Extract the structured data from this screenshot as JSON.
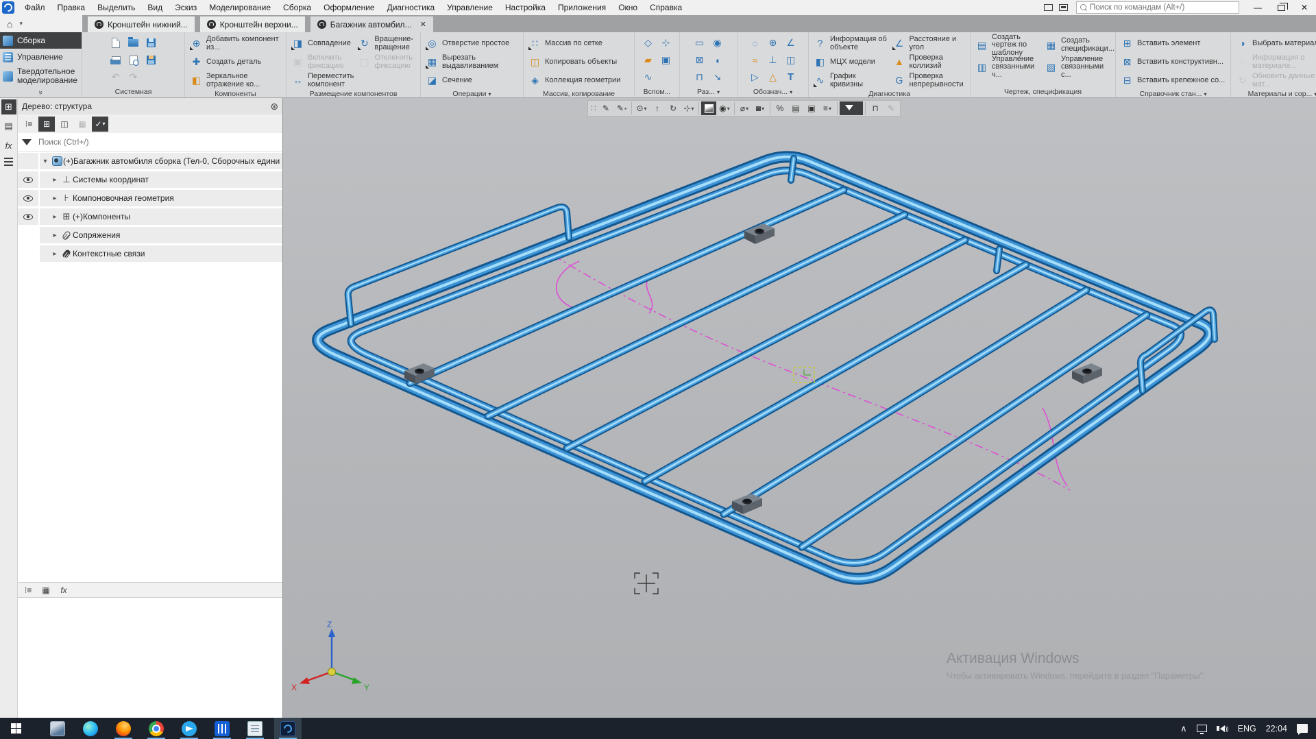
{
  "window": {
    "search_placeholder": "Поиск по командам (Alt+/)"
  },
  "menu": {
    "items": [
      "Файл",
      "Правка",
      "Выделить",
      "Вид",
      "Эскиз",
      "Моделирование",
      "Сборка",
      "Оформление",
      "Диагностика",
      "Управление",
      "Настройка",
      "Приложения",
      "Окно",
      "Справка"
    ]
  },
  "doc_tabs": {
    "close_glyph": "✕",
    "tabs": [
      {
        "label": "Кронштейн нижний..."
      },
      {
        "label": "Кронштейн верхни..."
      },
      {
        "label": "Багажник автомбил...",
        "active": true
      }
    ]
  },
  "mode_tabs": {
    "items": [
      "Сборка",
      "Управление",
      "Твердотельное моделирование"
    ]
  },
  "ribbon": {
    "groups": [
      {
        "label": "Системная",
        "icons": [
          "new-document",
          "open-document",
          "save",
          "print",
          "print-preview",
          "save-all",
          "undo",
          "redo"
        ]
      },
      {
        "label": "Компоненты",
        "buttons": [
          {
            "label": "Добавить компонент из..."
          },
          {
            "label": "Создать деталь"
          },
          {
            "label": "Зеркальное отражение ко..."
          }
        ],
        "icons": [
          "add-component",
          "create-part",
          "mirror-components"
        ]
      },
      {
        "label": "Размещение компонентов",
        "col1": [
          {
            "label": "Совпадение"
          },
          {
            "label": "Включить фиксацию",
            "disabled": true
          },
          {
            "label": "Переместить компонент"
          }
        ],
        "col2": [
          {
            "label": "Вращение-вращение"
          },
          {
            "label": "Отключить фиксацию",
            "disabled": true
          }
        ],
        "icons": [
          "coincident-mate",
          "enable-fixation",
          "move-component",
          "rotation-rotation",
          "disable-fixation"
        ]
      },
      {
        "label": "Операции",
        "dropdown": true,
        "buttons": [
          {
            "label": "Отверстие простое"
          },
          {
            "label": "Вырезать выдавливанием"
          },
          {
            "label": "Сечение"
          }
        ],
        "icons": [
          "simple-hole",
          "cut-extrude",
          "section"
        ]
      },
      {
        "label": "Массив, копирование",
        "buttons": [
          {
            "label": "Массив по сетке"
          },
          {
            "label": "Копировать объекты"
          },
          {
            "label": "Коллекция геометрии"
          }
        ],
        "icons": [
          "grid-array",
          "copy-objects",
          "geometry-collection"
        ]
      },
      {
        "label": "Вспом...",
        "icons": [
          "aux-plane",
          "aux-cs",
          "aux-layer",
          "aux-camera",
          "aux-spline"
        ]
      },
      {
        "label": "Раз...",
        "dropdown": true,
        "icons": [
          "section-view",
          "detail-view",
          "break-view",
          "removed-view",
          "scale-view",
          "bend-view"
        ]
      },
      {
        "label": "Обознач...",
        "dropdown": true,
        "icons": [
          "hole-mark",
          "axis-mark",
          "angle-mark",
          "leader",
          "slope",
          "datum",
          "flag",
          "tolerance",
          "text"
        ]
      },
      {
        "label": "Диагностика",
        "col1": [
          {
            "label": "Информация об объекте"
          },
          {
            "label": "МЦХ модели"
          },
          {
            "label": "График кривизны"
          }
        ],
        "col2": [
          {
            "label": "Расстояние и угол"
          },
          {
            "label": "Проверка коллизий"
          },
          {
            "label": "Проверка непрерывности"
          }
        ],
        "icons": [
          "object-info",
          "mass-properties",
          "curvature-graph",
          "distance-angle",
          "collision-check",
          "continuity-check"
        ]
      },
      {
        "label": "Чертеж, спецификация",
        "col1": [
          {
            "label": "Создать чертеж по шаблону"
          },
          {
            "label": "Управление связанными ч..."
          }
        ],
        "col2": [
          {
            "label": "Создать спецификаци..."
          },
          {
            "label": "Управление связанными с..."
          }
        ],
        "icons": [
          "create-drawing-template",
          "manage-linked-drawings",
          "create-specification",
          "manage-linked-specs"
        ]
      },
      {
        "label": "Справочник стан...",
        "dropdown": true,
        "buttons": [
          {
            "label": "Вставить элемент"
          },
          {
            "label": "Вставить конструктивн..."
          },
          {
            "label": "Вставить крепежное со..."
          }
        ],
        "icons": [
          "insert-element",
          "insert-constructive",
          "insert-fastener"
        ]
      },
      {
        "label": "Материалы и сор...",
        "dropdown": true,
        "buttons": [
          {
            "label": "Выбрать материал..."
          },
          {
            "label": "Информация о материале...",
            "disabled": true
          },
          {
            "label": "Обновить данные по мат...",
            "disabled": true
          }
        ],
        "icons": [
          "select-material",
          "material-info",
          "refresh-material-data"
        ]
      }
    ]
  },
  "tree": {
    "title": "Дерево: структура",
    "search_placeholder": "Поиск (Ctrl+/)",
    "root_label": "(+)Багажник автомбиля сборка (Тел-0, Сборочных едини",
    "items": [
      {
        "label": "Системы координат",
        "eye": true
      },
      {
        "label": "Компоновочная геометрия",
        "eye": true
      },
      {
        "label": "(+)Компоненты",
        "eye": true
      },
      {
        "label": "Сопряжения",
        "eye": false
      },
      {
        "label": "Контекстные связи",
        "eye": false
      }
    ],
    "side_icons": [
      "structure-tree",
      "parameters",
      "fx",
      "menu"
    ]
  },
  "viewport": {
    "toolbar_icons": [
      "grip",
      "sketch",
      "sketch-on-plane",
      "zoom",
      "zoom-fit",
      "rotate-view",
      "coordinate",
      "shaded-view",
      "orientation",
      "hide-objects",
      "snapshot",
      "clip-split",
      "notebook",
      "appearance",
      "scene-layers",
      "filter",
      "measure",
      "eyedropper"
    ],
    "watermark": {
      "title": "Активация Windows",
      "subtitle": "Чтобы активировать Windows, перейдите в раздел \"Параметры\"."
    },
    "triad": {
      "x": "X",
      "y": "Y",
      "z": "Z"
    }
  },
  "taskbar": {
    "apps": [
      "start",
      "virtualbox",
      "edge",
      "firefox",
      "chrome",
      "telegram",
      "reader",
      "notepad",
      "kompas"
    ],
    "lang": "ENG",
    "time": "22:04"
  }
}
